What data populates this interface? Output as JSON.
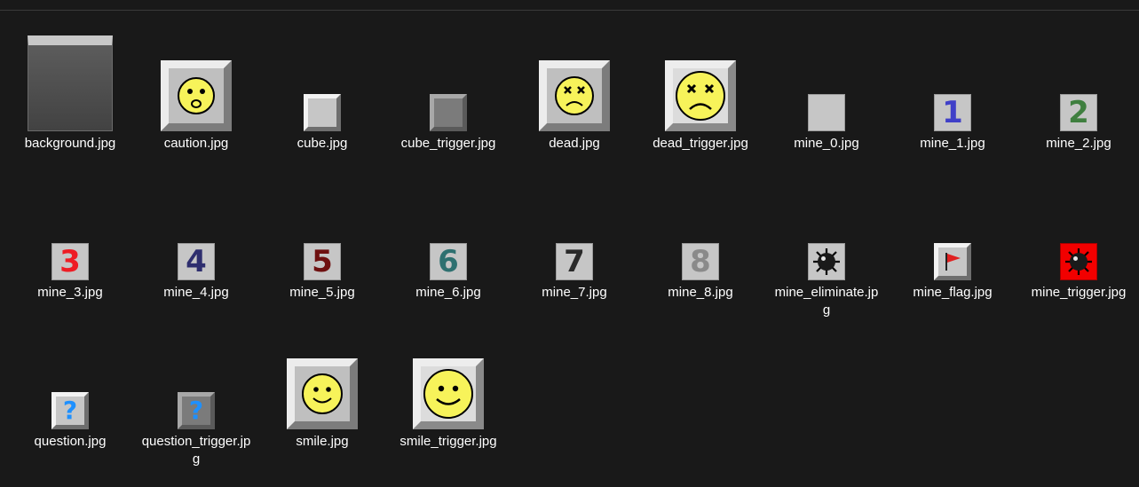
{
  "files": [
    {
      "name": "background.jpg"
    },
    {
      "name": "caution.jpg"
    },
    {
      "name": "cube.jpg"
    },
    {
      "name": "cube_trigger.jpg"
    },
    {
      "name": "dead.jpg"
    },
    {
      "name": "dead_trigger.jpg"
    },
    {
      "name": "mine_0.jpg"
    },
    {
      "name": "mine_1.jpg",
      "digit": "1",
      "color": "#4040c8"
    },
    {
      "name": "mine_2.jpg",
      "digit": "2",
      "color": "#3f7f3f"
    },
    {
      "name": "mine_3.jpg",
      "digit": "3",
      "color": "#ee1c24"
    },
    {
      "name": "mine_4.jpg",
      "digit": "4",
      "color": "#2e2e6e"
    },
    {
      "name": "mine_5.jpg",
      "digit": "5",
      "color": "#6e1010"
    },
    {
      "name": "mine_6.jpg",
      "digit": "6",
      "color": "#2e7070"
    },
    {
      "name": "mine_7.jpg",
      "digit": "7",
      "color": "#2a2a2a"
    },
    {
      "name": "mine_8.jpg",
      "digit": "8",
      "color": "#8a8a8a"
    },
    {
      "name": "mine_eliminate.jpg"
    },
    {
      "name": "mine_flag.jpg"
    },
    {
      "name": "mine_trigger.jpg"
    },
    {
      "name": "question.jpg",
      "glyph": "?"
    },
    {
      "name": "question_trigger.jpg",
      "glyph": "?"
    },
    {
      "name": "smile.jpg"
    },
    {
      "name": "smile_trigger.jpg"
    }
  ],
  "colors": {
    "background": "#191919",
    "text": "#ffffff",
    "face": "#f7f35a",
    "flag": "#e02020",
    "question": "#1e90ff"
  }
}
